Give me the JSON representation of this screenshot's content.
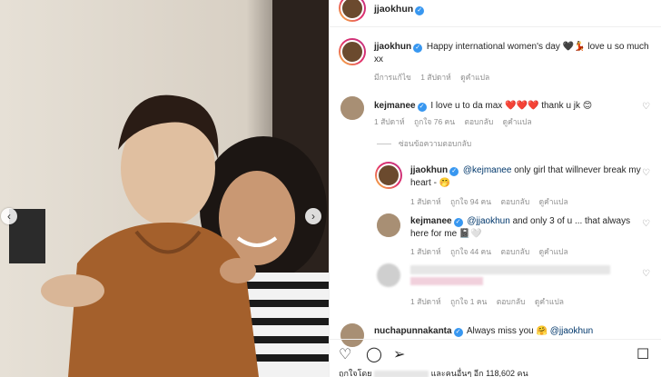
{
  "post": {
    "username": "jjaokhun",
    "caption_text": "Happy international women's day 🖤💃 love u so much xx",
    "caption_meta": [
      "มีการแก้ไข",
      "1 สัปดาห์",
      "ดูคำแปล"
    ]
  },
  "comments": [
    {
      "username": "kejmanee",
      "text": "I love u to da max ❤️❤️❤️ thank u jk 😊",
      "meta": [
        "1 สัปดาห์",
        "ถูกใจ 76 คน",
        "ตอบกลับ",
        "ดูคำแปล"
      ]
    }
  ],
  "hide_replies": "ซ่อนข้อความตอบกลับ",
  "replies": [
    {
      "username": "jjaokhun",
      "mention": "@kejmanee",
      "text": "only girl that willnever break my heart - 🤭",
      "meta": [
        "1 สัปดาห์",
        "ถูกใจ 94 คน",
        "ตอบกลับ",
        "ดูคำแปล"
      ]
    },
    {
      "username": "kejmanee",
      "mention": "@jjaokhun",
      "text": "and only 3 of u ... that always here for me 📓🤍",
      "meta": [
        "1 สัปดาห์",
        "ถูกใจ 44 คน",
        "ตอบกลับ",
        "ดูคำแปล"
      ]
    },
    {
      "username": "",
      "mention": "",
      "text": "",
      "meta": [
        "1 สัปดาห์",
        "ถูกใจ 1 คน",
        "ตอบกลับ",
        "ดูคำแปล"
      ]
    }
  ],
  "next_comment": {
    "username": "nuchapunnakanta",
    "text": "Always miss you 🤗",
    "mention": "@jjaokhun"
  },
  "likes_text": "ถูกใจโดย",
  "likes_count": "และคนอื่นๆ อีก 118,602 คน",
  "icons": {
    "verified": "✓",
    "heart_outline": "♡",
    "prev": "‹",
    "next": "›",
    "comment": "◯",
    "share": "➢",
    "save": "☐"
  },
  "colors": {
    "verified": "#3897f0",
    "link": "#00376b",
    "muted": "#8e8e8e"
  }
}
